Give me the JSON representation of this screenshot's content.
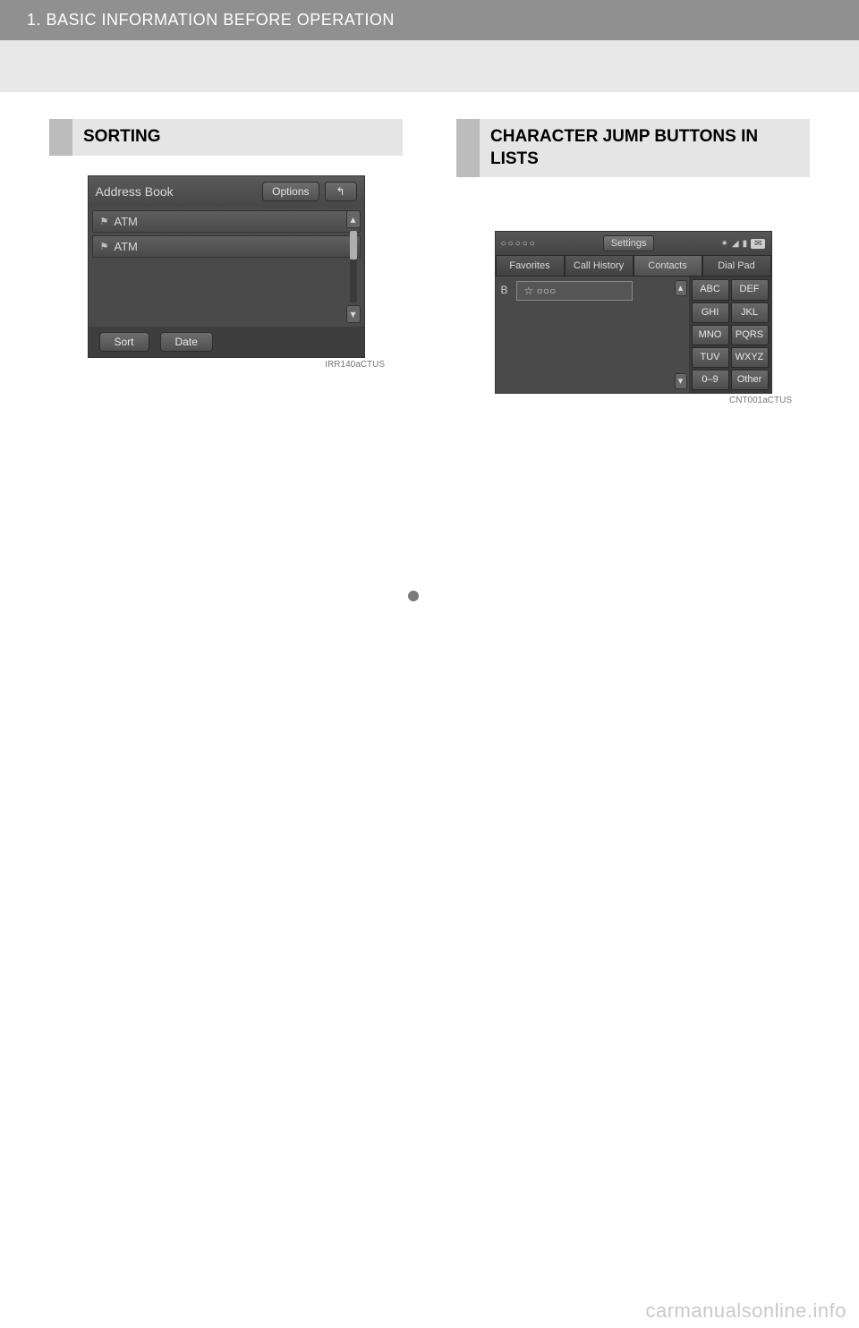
{
  "header": {
    "title": "1. BASIC INFORMATION BEFORE OPERATION"
  },
  "left": {
    "section_title": "SORTING",
    "address_book": {
      "title": "Address Book",
      "options_btn": "Options",
      "back_glyph": "↰",
      "rows": [
        "ATM",
        "ATM"
      ],
      "sort_btn": "Sort",
      "date_btn": "Date",
      "image_id": "IRR140aCTUS"
    }
  },
  "right": {
    "section_title": "CHARACTER JUMP BUTTONS IN LISTS",
    "contacts": {
      "dots": "○○○○○",
      "settings": "Settings",
      "tabs": [
        "Favorites",
        "Call History",
        "Contacts",
        "Dial Pad"
      ],
      "active_tab_index": 2,
      "list_letter": "B",
      "entry": "☆ ○○○",
      "keys": [
        "ABC",
        "DEF",
        "GHI",
        "JKL",
        "MNO",
        "PQRS",
        "TUV",
        "WXYZ",
        "0–9",
        "Other"
      ],
      "image_id": "CNT001aCTUS"
    }
  },
  "watermark": "carmanualsonline.info"
}
